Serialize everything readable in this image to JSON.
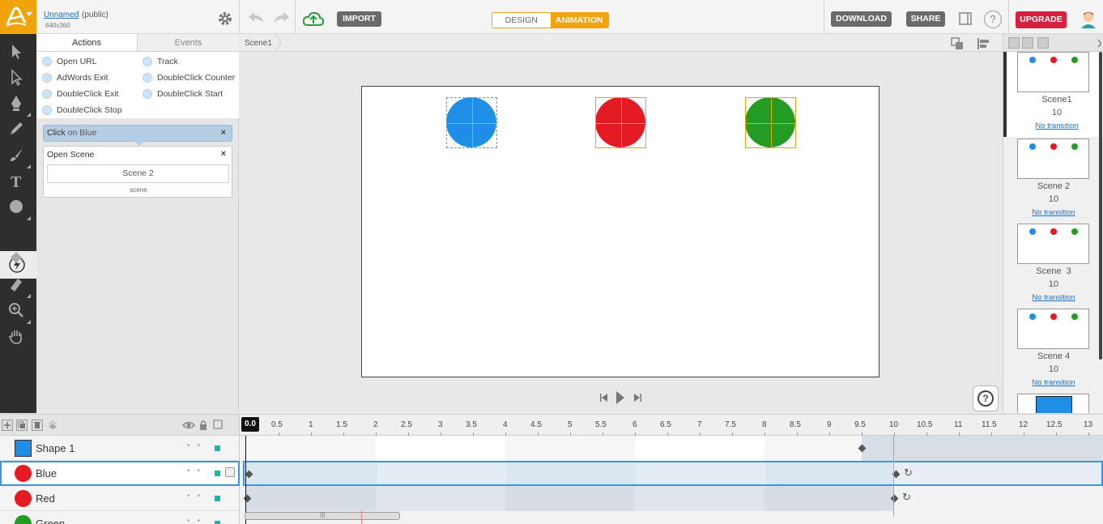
{
  "header": {
    "project_name": "Unnamed",
    "project_visibility": "(public)",
    "project_size": "640x360",
    "import_label": "IMPORT",
    "mode_design": "DESIGN",
    "mode_animation": "ANIMATION",
    "download_label": "DOWNLOAD",
    "share_label": "SHARE",
    "help_label": "?",
    "upgrade_label": "UPGRADE"
  },
  "actions_panel": {
    "tab_actions": "Actions",
    "tab_events": "Events",
    "actions": [
      "Open URL",
      "Track",
      "AdWords Exit",
      "DoubleClick Counter",
      "DoubleClick Exit",
      "DoubleClick Start",
      "DoubleClick Stop"
    ],
    "event": {
      "trigger": "Click",
      "on_word": "on Blue",
      "close": "×"
    },
    "action_card": {
      "title": "Open Scene",
      "close": "×",
      "scene_value": "Scene 2",
      "field_label": "scene"
    }
  },
  "stage": {
    "breadcrumb": "Scene1",
    "shapes": [
      {
        "name": "Blue",
        "color": "#1e8ee6"
      },
      {
        "name": "Red",
        "color": "#e41b22"
      },
      {
        "name": "Green",
        "color": "#229c22"
      }
    ],
    "help_label": "?"
  },
  "scenes": [
    {
      "name": "Scene1",
      "duration": "10",
      "transition": "No transition"
    },
    {
      "name": "Scene 2",
      "duration": "10",
      "transition": "No transition"
    },
    {
      "name": "Scene  3",
      "duration": "10",
      "transition": "No transition"
    },
    {
      "name": "Scene 4",
      "duration": "10",
      "transition": "No transition"
    }
  ],
  "timeline": {
    "playhead": "0.0",
    "ticks": [
      "0.5",
      "1",
      "1.5",
      "2",
      "2.5",
      "3",
      "3.5",
      "4",
      "4.5",
      "5",
      "5.5",
      "6",
      "6.5",
      "7",
      "7.5",
      "8",
      "8.5",
      "9",
      "9.5",
      "10",
      "10.5",
      "11",
      "11.5",
      "12",
      "12.5",
      "13"
    ],
    "layers": [
      {
        "name": "Shape 1",
        "color": "#1e8ee6",
        "shape": "square"
      },
      {
        "name": "Blue",
        "color": "#e41b22",
        "shape": "circle"
      },
      {
        "name": "Red",
        "color": "#e41b22",
        "shape": "circle"
      },
      {
        "name": "Green",
        "color": "#229c22",
        "shape": "circle"
      }
    ]
  },
  "colors": {
    "accent": "#f0a30a",
    "upgrade": "#d81f40",
    "link": "#1a73c8",
    "selection": "#3d95de"
  }
}
